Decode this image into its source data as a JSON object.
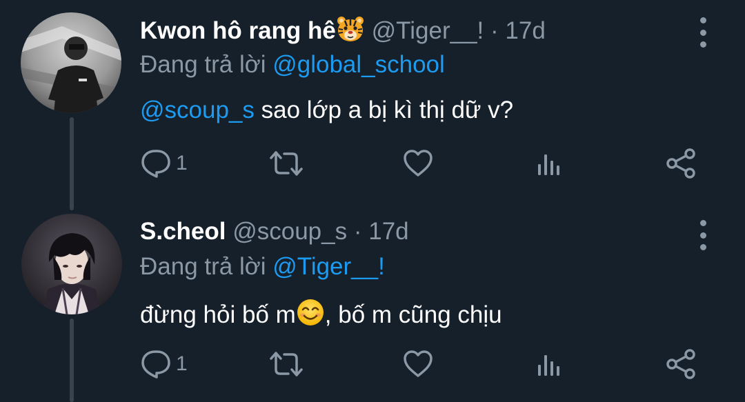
{
  "tweets": [
    {
      "display_name": "Kwon hô rang hê",
      "name_emoji": "tiger-face",
      "handle": "@Tiger__!",
      "separator": "·",
      "time": "17d",
      "reply_prefix": "Đang trả lời",
      "reply_to": "@global_school",
      "text_mention": "@scoup_s",
      "text_body": "sao lớp a bị kì thị dữ v?",
      "reply_count": "1"
    },
    {
      "display_name": "S.cheol",
      "handle": "@scoup_s",
      "separator": "·",
      "time": "17d",
      "reply_prefix": "Đang trả lời",
      "reply_to": "@Tiger__!",
      "text_before_emoji": "đừng hỏi bố m",
      "text_emoji": "smiling-face",
      "text_after_emoji": ", bố m cũng chịu",
      "reply_count": "1"
    }
  ],
  "colors": {
    "background": "#15202b",
    "text_primary": "#ffffff",
    "text_secondary": "#8b98a5",
    "link": "#1d9bf0",
    "thread_line": "#38444d"
  },
  "icons": [
    "reply-icon",
    "retweet-icon",
    "like-icon",
    "views-icon",
    "share-icon",
    "more-options-icon"
  ]
}
